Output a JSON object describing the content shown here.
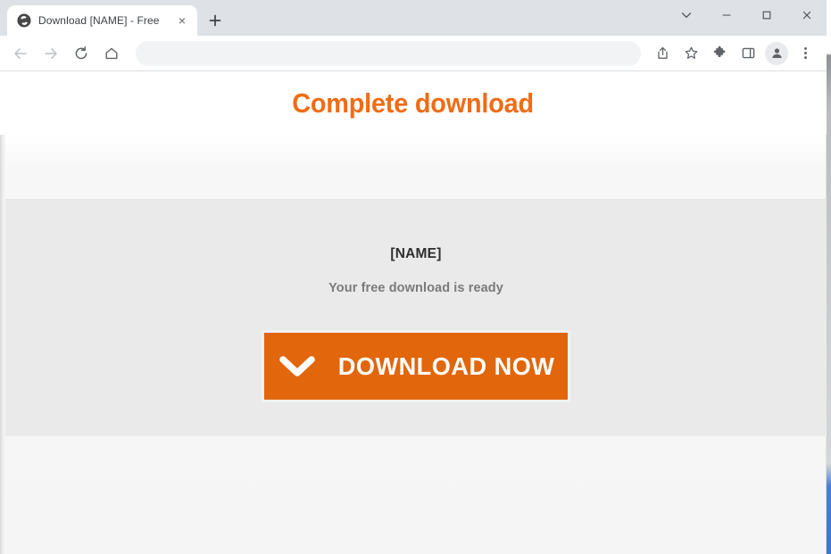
{
  "window": {
    "controls": {
      "tab_search_label": "Tab search",
      "minimize_label": "Minimize",
      "maximize_label": "Maximize",
      "close_label": "Close"
    }
  },
  "tabstrip": {
    "tabs": [
      {
        "title": "Download [NAME] - Free",
        "favicon": "globe-icon",
        "close_label": "×",
        "active": true
      }
    ],
    "new_tab_label": "+"
  },
  "toolbar": {
    "back_label": "Back",
    "forward_label": "Forward",
    "reload_label": "Reload",
    "home_label": "Home",
    "address": {
      "value": "",
      "placeholder": ""
    },
    "share_label": "Share this page",
    "bookmark_label": "Bookmark this tab",
    "extensions_label": "Extensions",
    "side_panel_label": "Side panel",
    "profile_label": "Profile",
    "menu_label": "Customize and control Google Chrome"
  },
  "page": {
    "heading": "Complete download",
    "card": {
      "file_name": "[NAME]",
      "ready_text": "Your free download is ready",
      "download_button_label": "DOWNLOAD NOW",
      "download_button_icon": "chevron-down-icon"
    }
  },
  "colors": {
    "accent_orange": "#EF6C16",
    "button_orange": "#E2660B",
    "card_background": "#EAEAEA",
    "page_background": "#F5F5F5",
    "tabstrip_background": "#DEE1E6"
  }
}
